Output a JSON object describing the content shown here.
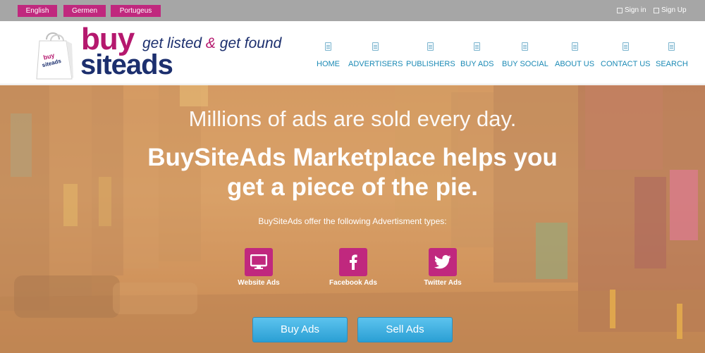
{
  "topbar": {
    "languages": [
      "English",
      "Germen",
      "Portugeus"
    ],
    "sign_in": "Sign in",
    "sign_up": "Sign Up"
  },
  "brand": {
    "logo_top": "buy",
    "logo_bottom": "siteads",
    "bag_text_1": "buy",
    "bag_text_2": "siteads",
    "tagline_1": "get listed",
    "tagline_amp": "&",
    "tagline_2": "get found"
  },
  "nav": [
    "HOME",
    "ADVERTISERS",
    "PUBLISHERS",
    "BUY ADS",
    "BUY SOCIAL",
    "ABOUT US",
    "CONTACT US",
    "SEARCH"
  ],
  "hero": {
    "subheading": "Millions of ads are sold every day.",
    "heading_line1": "BuySiteAds Marketplace helps you",
    "heading_line2": "get a piece of the pie.",
    "offer_text": "BuySiteAds offer the following Advertisment types:",
    "ad_types": [
      {
        "label": "Website Ads",
        "icon": "monitor-icon"
      },
      {
        "label": "Facebook Ads",
        "icon": "facebook-icon"
      },
      {
        "label": "Twitter Ads",
        "icon": "twitter-icon"
      }
    ],
    "buy_button": "Buy Ads",
    "sell_button": "Sell Ads"
  },
  "colors": {
    "accent": "#c0287e",
    "brand_navy": "#1c2f6e",
    "nav_link": "#1b8ab5",
    "button_blue": "#2b9fd4"
  }
}
